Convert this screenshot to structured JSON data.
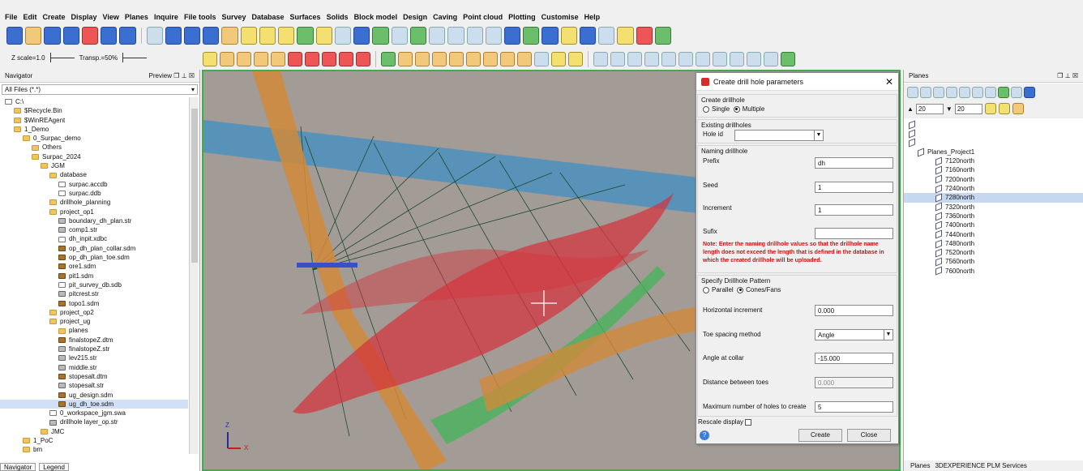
{
  "menu": [
    "File",
    "Edit",
    "Create",
    "Display",
    "View",
    "Planes",
    "Inquire",
    "File tools",
    "Survey",
    "Database",
    "Surfaces",
    "Solids",
    "Block model",
    "Design",
    "Caving",
    "Point cloud",
    "Plotting",
    "Customise",
    "Help"
  ],
  "zscale": {
    "label": "Z scale=1.0",
    "transp": "Transp.=50%"
  },
  "navigator": {
    "title": "Navigator",
    "preview": "Preview",
    "filter": "All Files (*.*)",
    "tree": [
      {
        "indent": 0,
        "icon": "disk",
        "label": "C:\\"
      },
      {
        "indent": 1,
        "icon": "folder",
        "label": "$Recycle.Bin"
      },
      {
        "indent": 1,
        "icon": "folder",
        "label": "$WinREAgent"
      },
      {
        "indent": 1,
        "icon": "folder",
        "label": "1_Demo"
      },
      {
        "indent": 2,
        "icon": "folder",
        "label": "0_Surpac_demo"
      },
      {
        "indent": 3,
        "icon": "folder",
        "label": "Others"
      },
      {
        "indent": 3,
        "icon": "folder",
        "label": "Surpac_2024"
      },
      {
        "indent": 4,
        "icon": "folder",
        "label": "JGM"
      },
      {
        "indent": 5,
        "icon": "folder",
        "label": "database"
      },
      {
        "indent": 6,
        "icon": "file",
        "label": "surpac.accdb"
      },
      {
        "indent": 6,
        "icon": "file",
        "label": "surpac.ddb"
      },
      {
        "indent": 5,
        "icon": "folder",
        "label": "drillhole_planning"
      },
      {
        "indent": 5,
        "icon": "folder",
        "label": "project_op1"
      },
      {
        "indent": 6,
        "icon": "str",
        "label": "boundary_dh_plan.str"
      },
      {
        "indent": 6,
        "icon": "str",
        "label": "comp1.str"
      },
      {
        "indent": 6,
        "icon": "file",
        "label": "dh_inpit.xdbc"
      },
      {
        "indent": 6,
        "icon": "mesh",
        "label": "op_dh_plan_collar.sdm"
      },
      {
        "indent": 6,
        "icon": "mesh",
        "label": "op_dh_plan_toe.sdm"
      },
      {
        "indent": 6,
        "icon": "mesh",
        "label": "ore1.sdm"
      },
      {
        "indent": 6,
        "icon": "mesh",
        "label": "pit1.sdm"
      },
      {
        "indent": 6,
        "icon": "file",
        "label": "pit_survey_db.sdb"
      },
      {
        "indent": 6,
        "icon": "str",
        "label": "pitcrest.str"
      },
      {
        "indent": 6,
        "icon": "mesh",
        "label": "topo1.sdm"
      },
      {
        "indent": 5,
        "icon": "folder",
        "label": "project_op2"
      },
      {
        "indent": 5,
        "icon": "folder",
        "label": "project_ug"
      },
      {
        "indent": 6,
        "icon": "folder",
        "label": "planes"
      },
      {
        "indent": 6,
        "icon": "mesh",
        "label": "finalstopeZ.dtm"
      },
      {
        "indent": 6,
        "icon": "str",
        "label": "finalstopeZ.str"
      },
      {
        "indent": 6,
        "icon": "str",
        "label": "lev215.str"
      },
      {
        "indent": 6,
        "icon": "str",
        "label": "middle.str"
      },
      {
        "indent": 6,
        "icon": "mesh",
        "label": "stopesalt.dtm"
      },
      {
        "indent": 6,
        "icon": "str",
        "label": "stopesalt.str"
      },
      {
        "indent": 6,
        "icon": "mesh",
        "label": "ug_design.sdm"
      },
      {
        "indent": 6,
        "icon": "mesh",
        "label": "ug_dh_toe.sdm",
        "selected": true
      },
      {
        "indent": 5,
        "icon": "file",
        "label": "0_workspace_jgm.swa"
      },
      {
        "indent": 5,
        "icon": "str",
        "label": "drillhole layer_op.str"
      },
      {
        "indent": 4,
        "icon": "folder",
        "label": "JMC"
      },
      {
        "indent": 2,
        "icon": "folder",
        "label": "1_PoC"
      },
      {
        "indent": 2,
        "icon": "folder",
        "label": "bm"
      }
    ],
    "tabs": [
      "Navigator",
      "Legend"
    ]
  },
  "dialog": {
    "title": "Create drill hole parameters",
    "create_group": "Create drillhole",
    "single": "Single",
    "multiple": "Multiple",
    "existing_group": "Existing drillholes",
    "hole_id_label": "Hole id",
    "hole_id_value": "",
    "naming_group": "Naming drillhole",
    "prefix_label": "Prefix",
    "prefix_value": "dh",
    "seed_label": "Seed",
    "seed_value": "1",
    "increment_label": "Increment",
    "increment_value": "1",
    "sufix_label": "Sufix",
    "sufix_value": "",
    "note": "Note: Enter the naming drillhole values so that the drillhole name length does not exceed the length that is defined in the database in which the created drillhole will be uploaded.",
    "pattern_group": "Specify Drillhole Pattern",
    "parallel": "Parallel",
    "cones": "Cones/Fans",
    "hinc_label": "Horizontal increment",
    "hinc_value": "0.000",
    "toe_label": "Toe spacing method",
    "toe_value": "Angle",
    "angle_label": "Angle at collar",
    "angle_value": "-15.000",
    "dist_label": "Distance between toes",
    "dist_value": "0.000",
    "max_label": "Maximum number of holes to create",
    "max_value": "5",
    "rescale": "Rescale display",
    "create_btn": "Create",
    "close_btn": "Close"
  },
  "planes": {
    "title": "Planes",
    "val1": "20",
    "val2": "20",
    "project": "Planes_Project1",
    "items": [
      "7120north",
      "7160north",
      "7200north",
      "7240north",
      "7280north",
      "7320north",
      "7360north",
      "7400north",
      "7440north",
      "7480north",
      "7520north",
      "7560north",
      "7600north"
    ],
    "selected": "7280north",
    "tabs": [
      "Planes",
      "3DEXPERIENCE PLM Services"
    ]
  },
  "view": {
    "axis_z": "Z",
    "axis_x": "X"
  },
  "colors": {
    "accent": "#3fae4a",
    "view_bg": "#a39b96",
    "ore": "#d6303a",
    "blue": "#3f8fc4",
    "orange": "#d18a3a",
    "green": "#49b35b"
  }
}
